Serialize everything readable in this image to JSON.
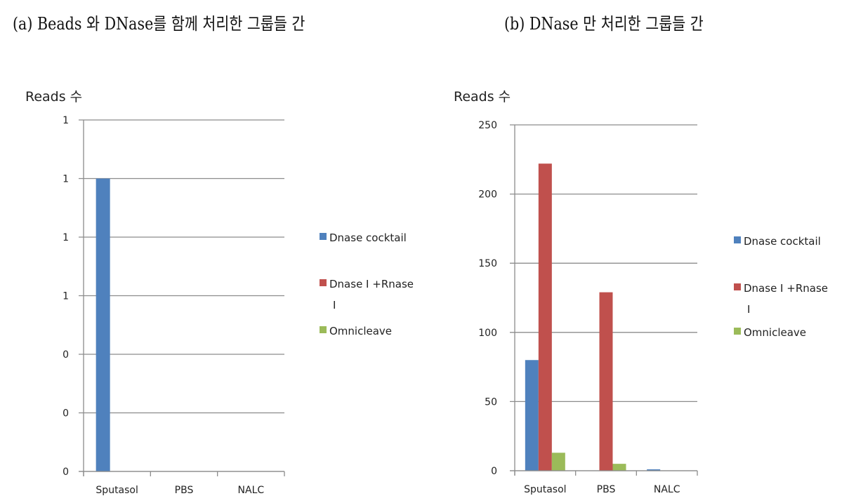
{
  "captions": {
    "a": "(a) Beads 와 DNase를 함께 처리한 그룹들 간",
    "b": "(b) DNase 만 처리한 그룹들 간"
  },
  "colors": {
    "Dnase cocktail": "#4f81bd",
    "Dnase I +Rnase I": "#c0504d",
    "Omnicleave": "#9bbb59"
  },
  "chart_data": [
    {
      "id": "a",
      "type": "bar",
      "title": "(a) Beads 와 DNase를 함께 처리한 그룹들 간",
      "xlabel": "",
      "ylabel": "Reads 수",
      "categories": [
        "Sputasol",
        "PBS",
        "NALC"
      ],
      "series": [
        {
          "name": "Dnase cocktail",
          "values": [
            1,
            0,
            0
          ]
        },
        {
          "name": "Dnase I +Rnase I",
          "values": [
            0,
            0,
            0
          ]
        },
        {
          "name": "Omnicleave",
          "values": [
            0,
            0,
            0
          ]
        }
      ],
      "ylim": [
        0,
        1.2
      ],
      "yticks": [
        0,
        0.2,
        0.4,
        0.6,
        0.8,
        1.0,
        1.2
      ],
      "ytick_labels": [
        "0",
        "0",
        "0",
        "1",
        "1",
        "1",
        "1"
      ],
      "legend_labels": [
        "Dnase cocktail",
        "Dnase I +Rnase",
        "I",
        "Omnicleave"
      ],
      "grid": true,
      "legend": "right"
    },
    {
      "id": "b",
      "type": "bar",
      "title": "(b) DNase 만 처리한 그룹들 간",
      "xlabel": "",
      "ylabel": "Reads 수",
      "categories": [
        "Sputasol",
        "PBS",
        "NALC"
      ],
      "series": [
        {
          "name": "Dnase cocktail",
          "values": [
            80,
            0,
            1
          ]
        },
        {
          "name": "Dnase I +Rnase I",
          "values": [
            222,
            129,
            0
          ]
        },
        {
          "name": "Omnicleave",
          "values": [
            13,
            5,
            0
          ]
        }
      ],
      "ylim": [
        0,
        250
      ],
      "yticks": [
        0,
        50,
        100,
        150,
        200,
        250
      ],
      "ytick_labels": [
        "0",
        "50",
        "100",
        "150",
        "200",
        "250"
      ],
      "legend_labels": [
        "Dnase cocktail",
        "Dnase I +Rnase",
        "I",
        "Omnicleave"
      ],
      "grid": true,
      "legend": "right"
    }
  ]
}
